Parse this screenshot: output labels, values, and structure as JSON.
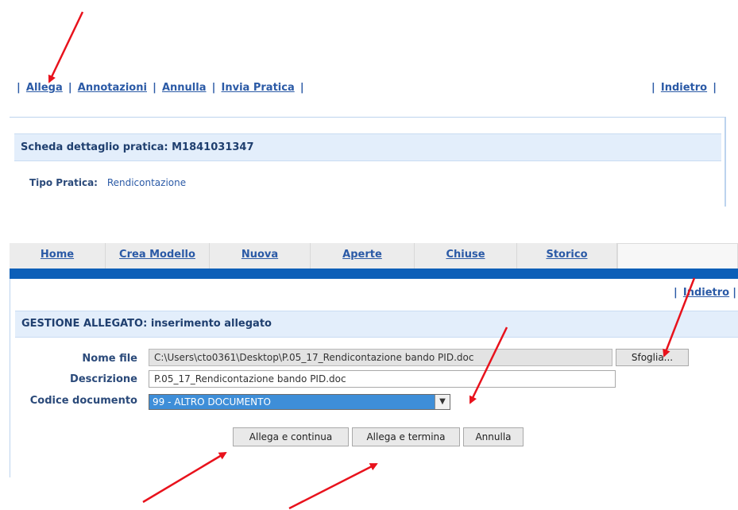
{
  "top_actions": {
    "allega": "Allega",
    "annotazioni": "Annotazioni",
    "annulla": "Annulla",
    "invia": "Invia Pratica",
    "indietro": "Indietro"
  },
  "detail": {
    "title": "Scheda dettaglio pratica: M1841031347",
    "tipo_label": "Tipo Pratica:",
    "tipo_value": "Rendicontazione"
  },
  "nav": {
    "tabs": [
      "Home",
      "Crea Modello",
      "Nuova",
      "Aperte",
      "Chiuse",
      "Storico"
    ]
  },
  "panel": {
    "back": "Indietro",
    "title": "GESTIONE ALLEGATO: inserimento allegato",
    "labels": {
      "nome_file": "Nome file",
      "descrizione": "Descrizione",
      "codice": "Codice documento"
    },
    "file_value": "C:\\Users\\cto0361\\Desktop\\P.05_17_Rendicontazione bando PID.doc",
    "browse_label": "Sfoglia...",
    "desc_value": "P.05_17_Rendicontazione bando PID.doc",
    "codice_value": "99 - ALTRO DOCUMENTO",
    "buttons": {
      "continua": "Allega e continua",
      "termina": "Allega e termina",
      "annulla": "Annulla"
    }
  },
  "colors": {
    "link": "#2b5aa6",
    "header_bg": "#e3eefb",
    "nav_bar": "#0d5fb8",
    "select_highlight": "#3e8ed8",
    "arrow": "#e8121c"
  }
}
